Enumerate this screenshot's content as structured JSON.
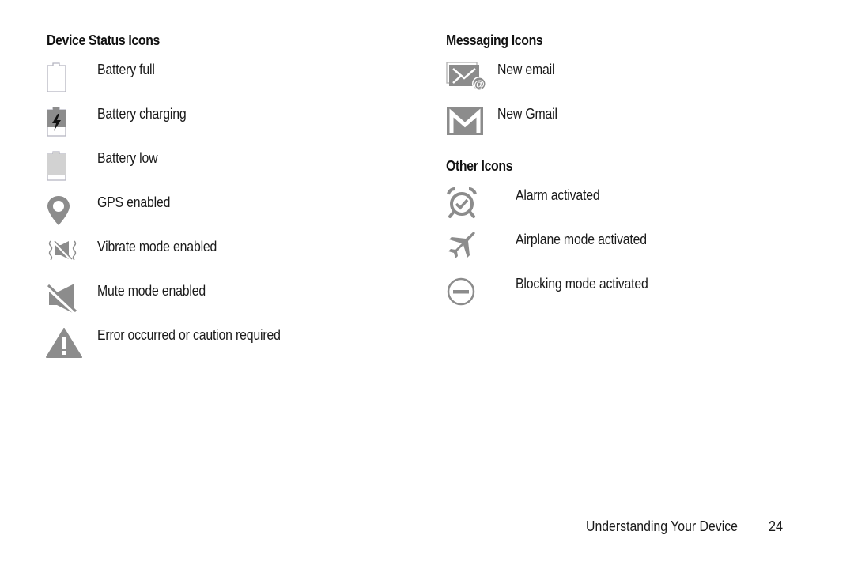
{
  "sections": {
    "device_status": {
      "title": "Device Status Icons",
      "items": [
        {
          "icon": "battery-full-icon",
          "label": "Battery full"
        },
        {
          "icon": "battery-charging-icon",
          "label": "Battery charging"
        },
        {
          "icon": "battery-low-icon",
          "label": "Battery low"
        },
        {
          "icon": "gps-icon",
          "label": "GPS enabled"
        },
        {
          "icon": "vibrate-icon",
          "label": "Vibrate mode enabled"
        },
        {
          "icon": "mute-icon",
          "label": "Mute mode enabled"
        },
        {
          "icon": "warning-icon",
          "label": "Error occurred or caution required"
        }
      ]
    },
    "messaging": {
      "title": "Messaging Icons",
      "items": [
        {
          "icon": "new-email-icon",
          "label": "New email"
        },
        {
          "icon": "gmail-icon",
          "label": "New Gmail"
        }
      ]
    },
    "other": {
      "title": "Other Icons",
      "items": [
        {
          "icon": "alarm-icon",
          "label": "Alarm activated"
        },
        {
          "icon": "airplane-icon",
          "label": "Airplane mode activated"
        },
        {
          "icon": "blocking-mode-icon",
          "label": "Blocking mode activated"
        }
      ]
    }
  },
  "footer": {
    "chapter_title": "Understanding Your Device",
    "page_number": "24"
  },
  "colors": {
    "icon_gray": "#8c8c8c",
    "text": "#1a1a1a"
  }
}
